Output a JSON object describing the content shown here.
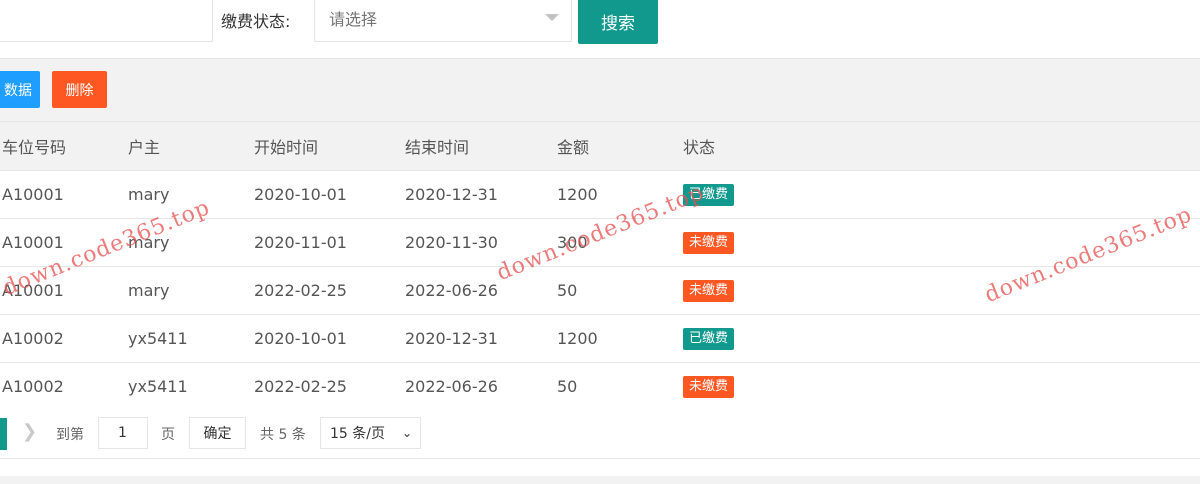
{
  "search": {
    "fee_status_label": "缴费状态:",
    "select_placeholder": "请选择",
    "search_button": "搜索"
  },
  "toolbar": {
    "data_button": "数据",
    "delete_button": "删除"
  },
  "table": {
    "headers": [
      "车位号码",
      "户主",
      "开始时间",
      "结束时间",
      "金额",
      "状态"
    ],
    "rows": [
      {
        "space": "A10001",
        "owner": "mary",
        "start": "2020-10-01",
        "end": "2020-12-31",
        "amount": "1200",
        "status": "已缴费",
        "paid": true
      },
      {
        "space": "A10001",
        "owner": "mary",
        "start": "2020-11-01",
        "end": "2020-11-30",
        "amount": "300",
        "status": "未缴费",
        "paid": false
      },
      {
        "space": "A10001",
        "owner": "mary",
        "start": "2022-02-25",
        "end": "2022-06-26",
        "amount": "50",
        "status": "未缴费",
        "paid": false
      },
      {
        "space": "A10002",
        "owner": "yx5411",
        "start": "2020-10-01",
        "end": "2020-12-31",
        "amount": "1200",
        "status": "已缴费",
        "paid": true
      },
      {
        "space": "A10002",
        "owner": "yx5411",
        "start": "2022-02-25",
        "end": "2022-06-26",
        "amount": "50",
        "status": "未缴费",
        "paid": false
      }
    ]
  },
  "pager": {
    "next_icon": "chevron-right-icon",
    "goto_label": "到第",
    "page_value": "1",
    "page_label": "页",
    "confirm_button": "确定",
    "total_text": "共 5 条",
    "page_size": "15 条/页"
  },
  "watermark": {
    "text_1": "down.code365.top",
    "text_2": "down.code365.top",
    "text_3": "down.code365.top"
  },
  "colors": {
    "primary": "#11998e",
    "danger": "#ff5722",
    "info": "#1e9fff"
  }
}
